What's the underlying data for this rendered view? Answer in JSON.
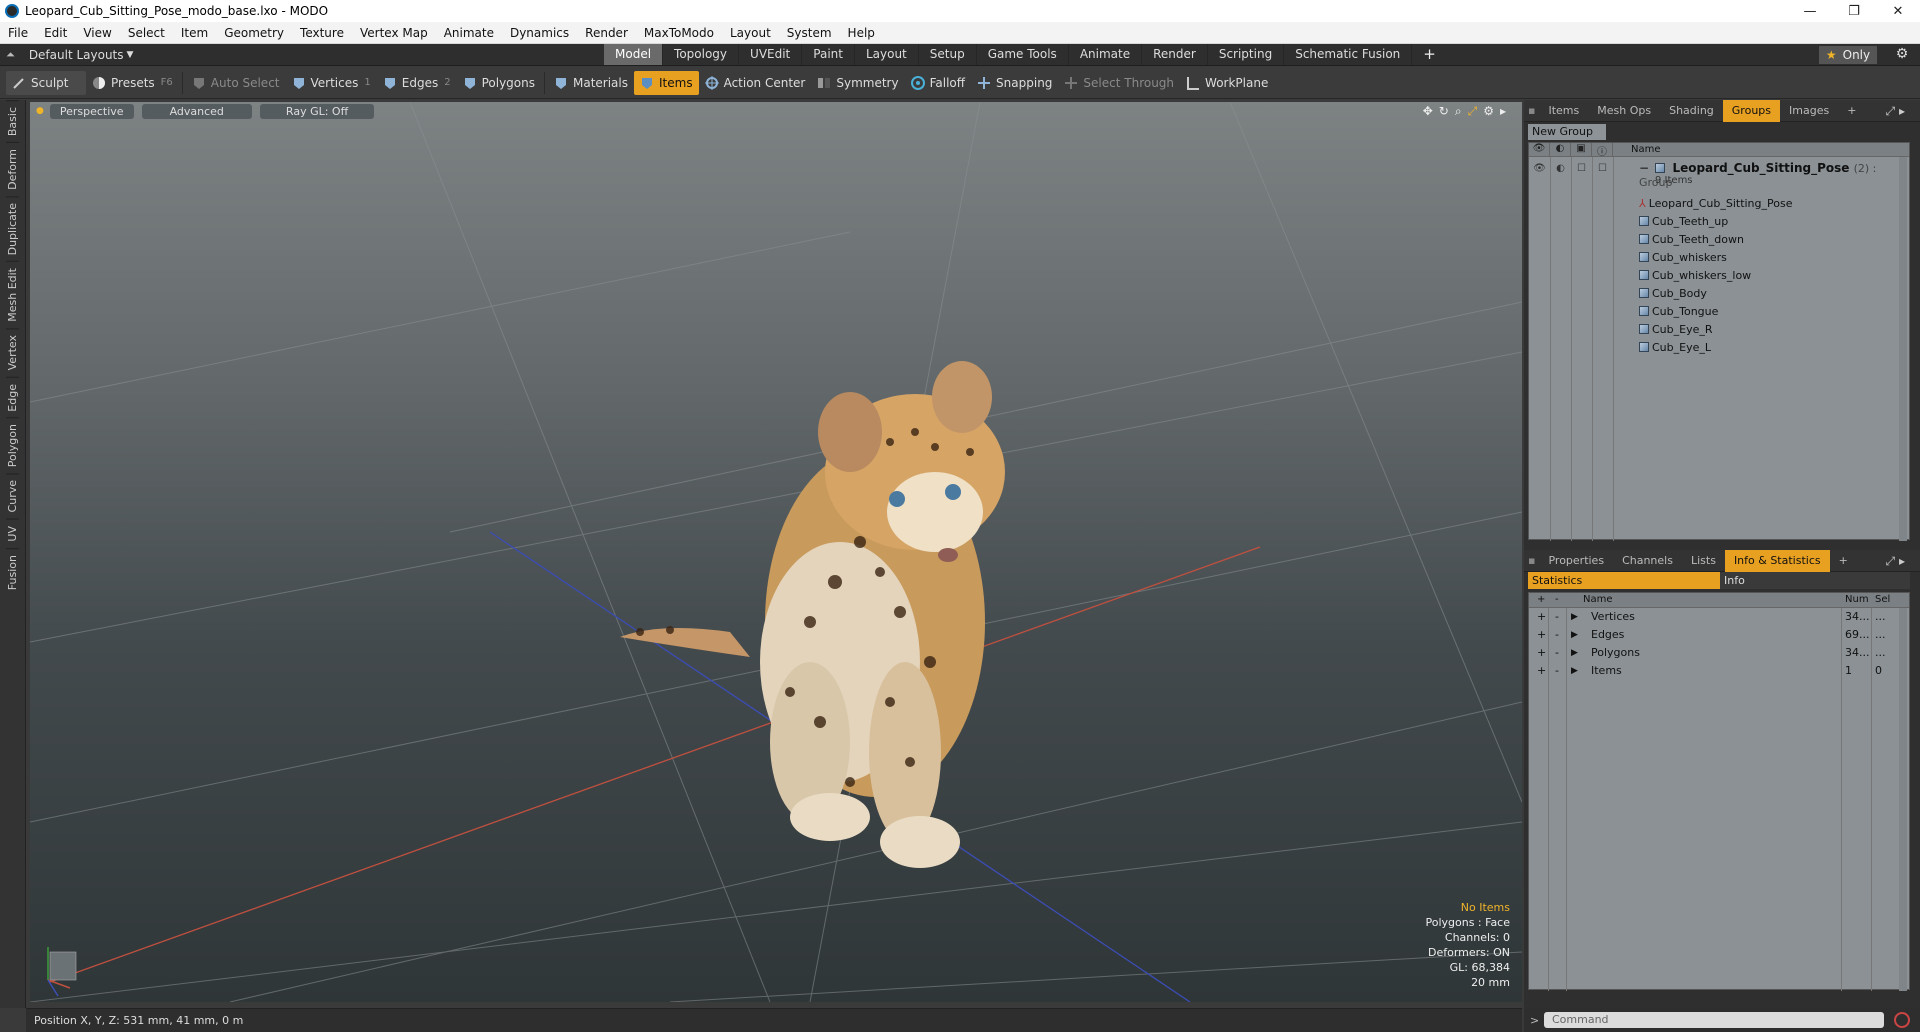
{
  "window": {
    "title": "Leopard_Cub_Sitting_Pose_modo_base.lxo - MODO",
    "min": "—",
    "max": "❐",
    "close": "✕"
  },
  "menu": [
    "File",
    "Edit",
    "View",
    "Select",
    "Item",
    "Geometry",
    "Texture",
    "Vertex Map",
    "Animate",
    "Dynamics",
    "Render",
    "MaxToModo",
    "Layout",
    "System",
    "Help"
  ],
  "layout": {
    "dropdown": "Default Layouts",
    "tabs": [
      "Model",
      "Topology",
      "UVEdit",
      "Paint",
      "Layout",
      "Setup",
      "Game Tools",
      "Animate",
      "Render",
      "Scripting",
      "Schematic Fusion"
    ],
    "active_tab": "Model",
    "only_label": "Only"
  },
  "toolbar": {
    "sculpt": "Sculpt",
    "presets": "Presets",
    "presets_key": "F6",
    "auto_select": "Auto Select",
    "vertices": "Vertices",
    "vertices_key": "1",
    "edges": "Edges",
    "edges_key": "2",
    "polygons": "Polygons",
    "materials": "Materials",
    "items": "Items",
    "action_center": "Action Center",
    "symmetry": "Symmetry",
    "falloff": "Falloff",
    "snapping": "Snapping",
    "select_through": "Select Through",
    "workplane": "WorkPlane"
  },
  "side_tabs": [
    "Basic",
    "Deform",
    "Duplicate",
    "Mesh Edit",
    "Vertex",
    "Edge",
    "Polygon",
    "Curve",
    "UV",
    "Fusion"
  ],
  "viewport": {
    "perspective": "Perspective",
    "advanced": "Advanced",
    "raygl": "Ray GL: Off",
    "overlay": {
      "no_items": "No Items",
      "polygons": "Polygons : Face",
      "channels": "Channels: 0",
      "deformers": "Deformers: ON",
      "gl": "GL: 68,384",
      "scale": "20 mm"
    }
  },
  "status": {
    "position": "Position X, Y, Z:   531 mm, 41 mm, 0 m"
  },
  "groups_panel": {
    "tabs": [
      "Items",
      "Mesh Ops",
      "Shading",
      "Groups",
      "Images"
    ],
    "active": "Groups",
    "new_group": "New Group",
    "name_header": "Name",
    "root": {
      "name": "Leopard_Cub_Sitting_Pose",
      "suffix": "(2) : Group",
      "count": "9 Items"
    },
    "children": [
      "Leopard_Cub_Sitting_Pose",
      "Cub_Teeth_up",
      "Cub_Teeth_down",
      "Cub_whiskers",
      "Cub_whiskers_low",
      "Cub_Body",
      "Cub_Tongue",
      "Cub_Eye_R",
      "Cub_Eye_L"
    ]
  },
  "info_panel": {
    "tabs": [
      "Properties",
      "Channels",
      "Lists",
      "Info & Statistics"
    ],
    "active": "Info & Statistics",
    "statistics_tab": "Statistics",
    "info_tab": "Info",
    "headers": {
      "name": "Name",
      "num": "Num",
      "sel": "Sel"
    },
    "rows": [
      {
        "name": "Vertices",
        "num": "34...",
        "sel": "..."
      },
      {
        "name": "Edges",
        "num": "69...",
        "sel": "..."
      },
      {
        "name": "Polygons",
        "num": "34...",
        "sel": "..."
      },
      {
        "name": "Items",
        "num": "1",
        "sel": "0"
      }
    ]
  },
  "command": {
    "placeholder": "Command"
  }
}
